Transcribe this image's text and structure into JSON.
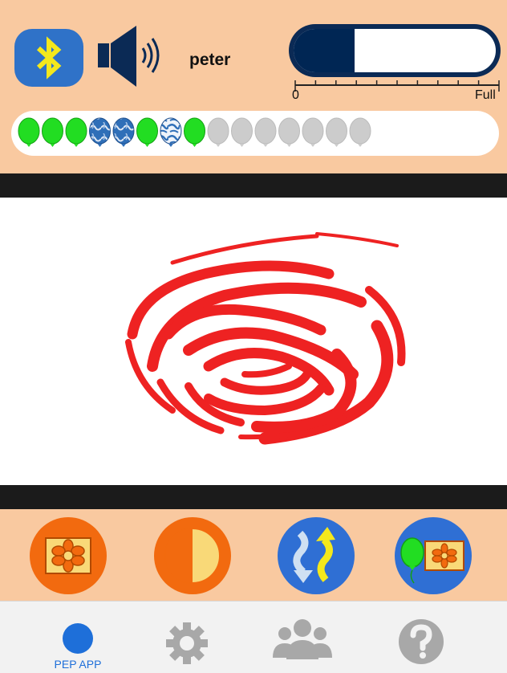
{
  "header": {
    "user_name": "peter",
    "gauge": {
      "min_label": "0",
      "max_label": "Full",
      "level_fraction": 0.3
    },
    "icons": {
      "bluetooth": "bluetooth-icon",
      "speaker": "speaker-icon"
    }
  },
  "balloons": {
    "slots": [
      "green",
      "green",
      "green",
      "blue-marble",
      "blue-marble",
      "green",
      "blue-white-marble",
      "green",
      "grey",
      "grey",
      "grey",
      "grey",
      "grey",
      "grey",
      "grey"
    ]
  },
  "display": {
    "image": "red-swirl"
  },
  "actions": [
    {
      "icon": "flower-card-icon"
    },
    {
      "icon": "half-circle-icon"
    },
    {
      "icon": "up-down-arrows-icon"
    },
    {
      "icon": "balloon-flower-card-icon"
    }
  ],
  "tabs": [
    {
      "label": "PEP APP",
      "icon": "dot-icon",
      "active": true
    },
    {
      "label": "",
      "icon": "gear-icon"
    },
    {
      "label": "",
      "icon": "group-icon"
    },
    {
      "label": "",
      "icon": "help-icon"
    }
  ],
  "colors": {
    "panel": "#f9c9a0",
    "accent_blue": "#1e6fd9",
    "navy": "#002654",
    "balloon_green": "#22dd22",
    "balloon_grey": "#cccccc",
    "swirl_red": "#ee2222"
  }
}
